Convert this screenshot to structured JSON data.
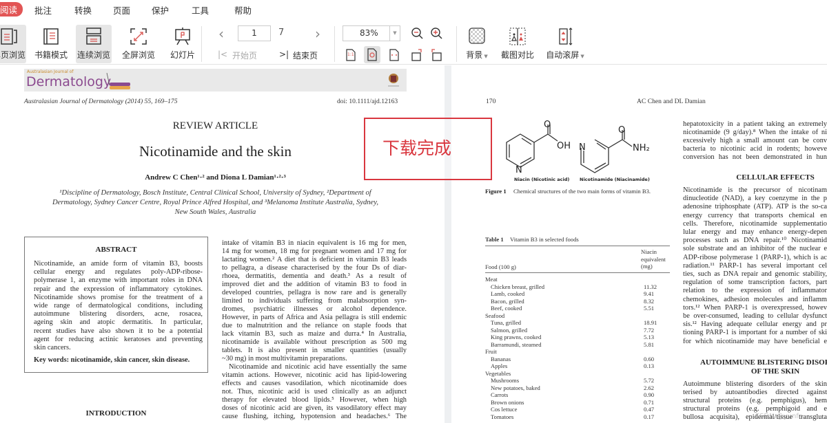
{
  "menu": {
    "items": [
      "阅读",
      "批注",
      "转换",
      "页面",
      "保护",
      "工具",
      "帮助"
    ],
    "active": "阅读"
  },
  "toolbar": {
    "single_page": "单页浏览",
    "book_mode": "书籍模式",
    "continuous": "连续浏览",
    "fullscreen": "全屏浏览",
    "slideshow": "幻灯片",
    "prev": "‹",
    "next": "›",
    "current_page": "1",
    "total_pages": "7",
    "first_page": "开始页",
    "last_page": "结束页",
    "zoom": "83%",
    "background": "背景",
    "screenshot_compare": "截图对比",
    "auto_scroll": "自动滚屏",
    "actual_size": "1:1"
  },
  "colors": {
    "accent": "#e25555",
    "notice_border": "#d9363e"
  },
  "notice": {
    "text": "下载完成"
  },
  "left_page": {
    "banner_small": "Australasian Journal of",
    "banner_title": "Dermatology",
    "journal_ref": "Australasian Journal of Dermatology (2014) 55, 169–175",
    "doi": "doi: 10.1111/ajd.12163",
    "article_type": "REVIEW ARTICLE",
    "title": "Nicotinamide and the skin",
    "authors": "Andrew C Chen¹·² and Diona L Damian¹·²·³",
    "affiliation": [
      "¹Discipline of Dermatology, Bosch Institute, Central Clinical School, University of Sydney, ²Department of",
      "Dermatology, Sydney Cancer Centre, Royal Prince Alfred Hospital, and ³Melanoma Institute Australia, Sydney,",
      "New South Wales, Australia"
    ],
    "abstract_heading": "ABSTRACT",
    "abstract_lines": [
      "Nicotinamide, an amide form of vitamin B3, boosts",
      "cellular energy and regulates poly-ADP-ribose-",
      "polymerase 1, an enzyme with important roles in DNA",
      "repair and the expression of inflammatory cytokines.",
      "Nicotinamide shows promise for the treatment of a",
      "wide range of dermatological conditions, including",
      "autoimmune blistering disorders, acne, rosacea,",
      "ageing skin and atopic dermatitis. In particular,",
      "recent studies have also shown it to be a potential",
      "agent for reducing actinic keratoses and preventing",
      "skin cancers."
    ],
    "keywords": "Key words: nicotinamide, skin cancer, skin disease.",
    "intro_heading": "INTRODUCTION",
    "column_lines": [
      "intake of vitamin B3 in niacin equivalent is 16 mg for men,",
      "14 mg for women, 18 mg for pregnant women and 17 mg for",
      "lactating women.² A diet that is deficient in vitamin B3 leads",
      "to pellagra, a disease characterised by the four Ds of diar-",
      "rhoea, dermatitis, dementia and death.³ As a result of",
      "improved diet and the addition of vitamin B3 to food in",
      "developed countries, pellagra is now rare and is generally",
      "limited to individuals suffering from malabsorption syn-",
      "dromes, psychiatric illnesses or alcohol dependence.",
      "However, in parts of Africa and Asia pellagra is still endemic",
      "due to malnutrition and the reliance on staple foods that",
      "lack vitamin B3, such as maize and durra.⁴ In Australia,",
      "nicotinamide is available without prescription as 500 mg",
      "tablets. It is also present in smaller quantities (usually",
      "~30 mg) in most multivitamin preparations.",
      "Nicotinamide and nicotinic acid have essentially the same",
      "vitamin actions. However, nicotinic acid has lipid-lowering",
      "effects and causes vasodilation, which nicotinamide does",
      "not. Thus, nicotinic acid is used clinically as an adjunct",
      "therapy for elevated blood lipids.⁵ However, when high",
      "doses of nicotinic acid are given, its vasodilatory effect may",
      "cause flushing, itching, hypotension and headaches.⁶ The"
    ]
  },
  "right_page": {
    "page_number": "170",
    "running_head": "AC Chen and DL Damian",
    "figure": {
      "niacin_label": "Niacin (Nicotinic acid)",
      "nicotinamide_label": "Nicotinamide (Niacinamide)",
      "oh": "OH",
      "nh2": "NH₂",
      "n": "N",
      "o": "O",
      "caption_label": "Figure 1",
      "caption": "Chemical structures of the two main forms of vitamin B3."
    },
    "table": {
      "label": "Table 1",
      "caption": "Vitamin B3 in selected foods",
      "col1": "Food (100 g)",
      "col2": [
        "Niacin",
        "equivalent",
        "(mg)"
      ],
      "rows": [
        {
          "food": "Meat",
          "value": "",
          "group": true
        },
        {
          "food": "Chicken breast, grilled",
          "value": "11.32"
        },
        {
          "food": "Lamb, cooked",
          "value": "9.41"
        },
        {
          "food": "Bacon, grilled",
          "value": "8.32"
        },
        {
          "food": "Beef, cooked",
          "value": "5.51"
        },
        {
          "food": "Seafood",
          "value": "",
          "group": true
        },
        {
          "food": "Tuna, grilled",
          "value": "18.91"
        },
        {
          "food": "Salmon, grilled",
          "value": "7.72"
        },
        {
          "food": "King prawns, cooked",
          "value": "5.13"
        },
        {
          "food": "Barramundi, steamed",
          "value": "5.81"
        },
        {
          "food": "Fruit",
          "value": "",
          "group": true
        },
        {
          "food": "Bananas",
          "value": "0.60"
        },
        {
          "food": "Apples",
          "value": "0.13"
        },
        {
          "food": "Vegetables",
          "value": "",
          "group": true
        },
        {
          "food": "Mushrooms",
          "value": "5.72"
        },
        {
          "food": "New potatoes, baked",
          "value": "2.62"
        },
        {
          "food": "Carrots",
          "value": "0.90"
        },
        {
          "food": "Brown onions",
          "value": "0.71"
        },
        {
          "food": "Cos lettuce",
          "value": "0.47"
        },
        {
          "food": "Tomatoes",
          "value": "0.17"
        }
      ]
    },
    "para1": [
      "hepatotoxicity in a patient taking an extremely",
      "nicotinamide (9 g/day).⁸ When the intake of ni",
      "excessively high a small amount can be conv",
      "bacteria to nicotinic acid in rodents; howeve",
      "conversion has not been demonstrated in hun"
    ],
    "heading_cellular": "CELLULAR EFFECTS",
    "para2": [
      "Nicotinamide is the precursor of nicotinam",
      "dinucleotide (NAD), a key coenzyme in the p",
      "adenosine triphosphate (ATP). ATP is the so-ca",
      "energy currency that transports chemical en",
      "cells. Therefore, nicotinamide supplementatio",
      "lular energy and may enhance energy-depen",
      "processes such as DNA repair.¹⁰ Nicotinamid",
      "sole substrate and an inhibitor of the nuclear e",
      "ADP-ribose polymerase 1 (PARP-1), which is ac",
      "radiation.¹¹ PARP-1 has several important cel",
      "ties, such as DNA repair and genomic stability,",
      "regulation of some transcription factors, part",
      "relation to the expression of inflammator",
      "chemokines, adhesion molecules and inflamm",
      "tors.¹² When PARP-1 is overexpressed, howev",
      "be over-consumed, leading to cellular dysfunct",
      "sis.¹² Having adequate cellular energy and pr",
      "tioning PARP-1 is important for a number of ski",
      "for which nicotinamide may have beneficial e"
    ],
    "heading_autoimmune": [
      "AUTOIMMUNE BLISTERING DISORDERS",
      "OF THE SKIN"
    ],
    "para3": [
      "Autoimmune blistering disorders of the skin",
      "terised by autoantibodies directed against",
      "structural proteins (e.g. pemphigus), hem",
      "structural proteins (e.g. pemphigoid and e",
      "bullosa acquisita), epidermal/tissue transgluta"
    ]
  },
  "watermark": "CSDN @yunfn"
}
